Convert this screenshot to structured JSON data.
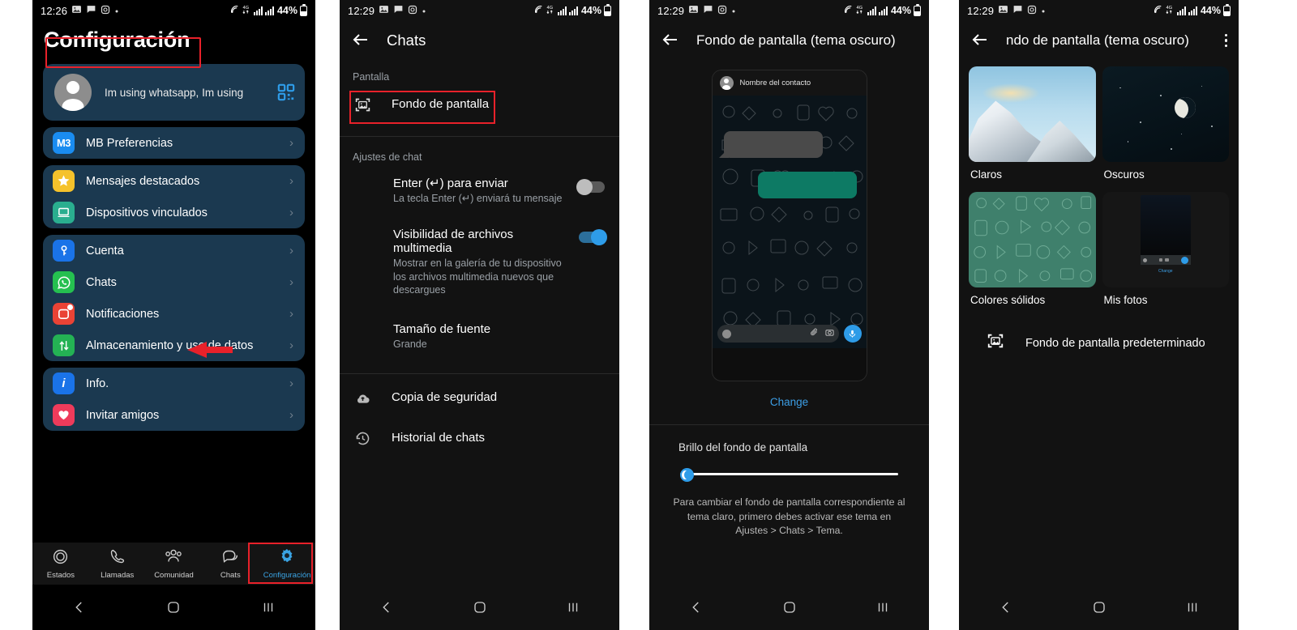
{
  "panels": {
    "p1": {
      "status": {
        "time": "12:26",
        "battery_pct": "44%"
      },
      "title": "Configuración",
      "profile": {
        "status_text": "Im using whatsapp, Im using"
      },
      "groups": [
        {
          "items": [
            {
              "label": "MB Preferencias",
              "icon": "mb-icon"
            }
          ]
        },
        {
          "items": [
            {
              "label": "Mensajes destacados",
              "icon": "star-icon"
            },
            {
              "label": "Dispositivos vinculados",
              "icon": "laptop-icon"
            }
          ]
        },
        {
          "items": [
            {
              "label": "Cuenta",
              "icon": "key-icon"
            },
            {
              "label": "Chats",
              "icon": "whatsapp-icon"
            },
            {
              "label": "Notificaciones",
              "icon": "bell-notification-icon"
            },
            {
              "label": "Almacenamiento y uso de datos",
              "icon": "data-arrows-icon"
            }
          ]
        },
        {
          "items": [
            {
              "label": "Info.",
              "icon": "info-icon"
            },
            {
              "label": "Invitar amigos",
              "icon": "heart-icon"
            }
          ]
        }
      ],
      "bottomnav": [
        {
          "label": "Estados",
          "icon": "status-ring-icon",
          "active": false
        },
        {
          "label": "Llamadas",
          "icon": "phone-icon",
          "active": false
        },
        {
          "label": "Comunidad",
          "icon": "community-icon",
          "active": false
        },
        {
          "label": "Chats",
          "icon": "chat-bubbles-icon",
          "active": false
        },
        {
          "label": "Configuración",
          "icon": "gear-icon",
          "active": true
        }
      ]
    },
    "p2": {
      "status": {
        "time": "12:29",
        "battery_pct": "44%"
      },
      "title": "Chats",
      "section_pantalla": "Pantalla",
      "wallpaper_item": "Fondo de pantalla",
      "section_ajustes": "Ajustes de chat",
      "settings": [
        {
          "title": "Enter (↵) para enviar",
          "subtitle": "La tecla Enter (↵) enviará tu mensaje",
          "toggle": "off"
        },
        {
          "title": "Visibilidad de archivos multimedia",
          "subtitle": "Mostrar en la galería de tu dispositivo los archivos multimedia nuevos que descargues",
          "toggle": "on"
        },
        {
          "title": "Tamaño de fuente",
          "subtitle": "Grande",
          "toggle": "none"
        }
      ],
      "rows": [
        {
          "label": "Copia de seguridad",
          "icon": "cloud-upload-icon"
        },
        {
          "label": "Historial de chats",
          "icon": "history-clock-icon"
        }
      ]
    },
    "p3": {
      "status": {
        "time": "12:29",
        "battery_pct": "44%"
      },
      "title": "Fondo de pantalla (tema oscuro)",
      "preview": {
        "contact_name": "Nombre del contacto"
      },
      "change_label": "Change",
      "brightness_label": "Brillo del fondo de pantalla",
      "brightness_value": 3,
      "note": "Para cambiar el fondo de pantalla correspondiente al tema claro, primero debes activar ese tema en Ajustes > Chats > Tema."
    },
    "p4": {
      "status": {
        "time": "12:29",
        "battery_pct": "44%"
      },
      "title": "ndo de pantalla (tema oscuro)",
      "categories": [
        {
          "label": "Claros",
          "thumb": "mountain-photo"
        },
        {
          "label": "Oscuros",
          "thumb": "moon-night-photo"
        },
        {
          "label": "Colores sólidos",
          "thumb": "green-doodle-pattern"
        },
        {
          "label": "Mis fotos",
          "thumb": "my-photos-preview"
        }
      ],
      "mini_change_label": "Change",
      "default_wallpaper": "Fondo de pantalla predeterminado"
    }
  },
  "colors": {
    "card_bg": "#1b3950",
    "highlight_red": "#e8212a",
    "accent_blue": "#2e9ce8",
    "link_blue": "#3c9ee5",
    "whatsapp_green": "#25d366",
    "bubble_green": "#0d7a64",
    "solid_green": "#3f806c"
  }
}
